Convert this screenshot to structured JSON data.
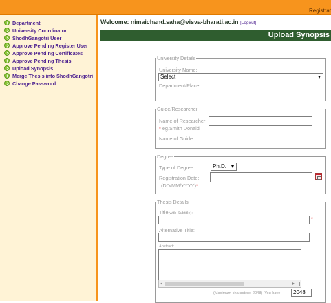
{
  "topbar": {
    "registration_text": "Registrat"
  },
  "sidebar": {
    "items": [
      {
        "label": "Department"
      },
      {
        "label": "University Coordinator"
      },
      {
        "label": "ShodhGangotri User"
      },
      {
        "label": "Approve Pending Register User"
      },
      {
        "label": "Approve Pending Certificates"
      },
      {
        "label": "Approve Pending Thesis"
      },
      {
        "label": "Upload Synopsis"
      },
      {
        "label": "Merge Thesis into ShodhGangotri"
      },
      {
        "label": "Change Password"
      }
    ]
  },
  "header": {
    "welcome_text": "Welcome: nimaichand.saha@visva-bharati.ac.in",
    "logout_label": "|Logout|",
    "page_title": "Upload Synopsis"
  },
  "form": {
    "university": {
      "legend": "University Details",
      "name_label": "University Name:",
      "name_value": "Select",
      "dept_label": "Department/Place:"
    },
    "guide": {
      "legend": "Guide/Researcher",
      "researcher_label": "Name of Researcher:",
      "example_hint": "eg.Smith Donald",
      "required_mark": "*",
      "guide_label": "Name of Guide:"
    },
    "degree": {
      "legend": "Degree",
      "type_label": "Type of Degree:",
      "type_value": "Ph.D.",
      "reg_date_label": "Registration Date:",
      "reg_date_format": "(DD/MM/YYYY)",
      "required_mark": "*"
    },
    "thesis": {
      "legend": "Thesis Details",
      "title_label": "Title",
      "title_sub": "(with Subtitle):",
      "required_mark": "*",
      "alt_title_label": "Alternative Title:",
      "abstract_label": "Abstract:",
      "max_chars_text": "(Maximum characters: 2048)",
      "you_have_text": "You have",
      "chars_remaining": "2048"
    }
  },
  "colors": {
    "accent_orange": "#f7941d",
    "title_green": "#2f5d2f",
    "nav_purple": "#4b1f8f",
    "required_red": "#e01010"
  }
}
